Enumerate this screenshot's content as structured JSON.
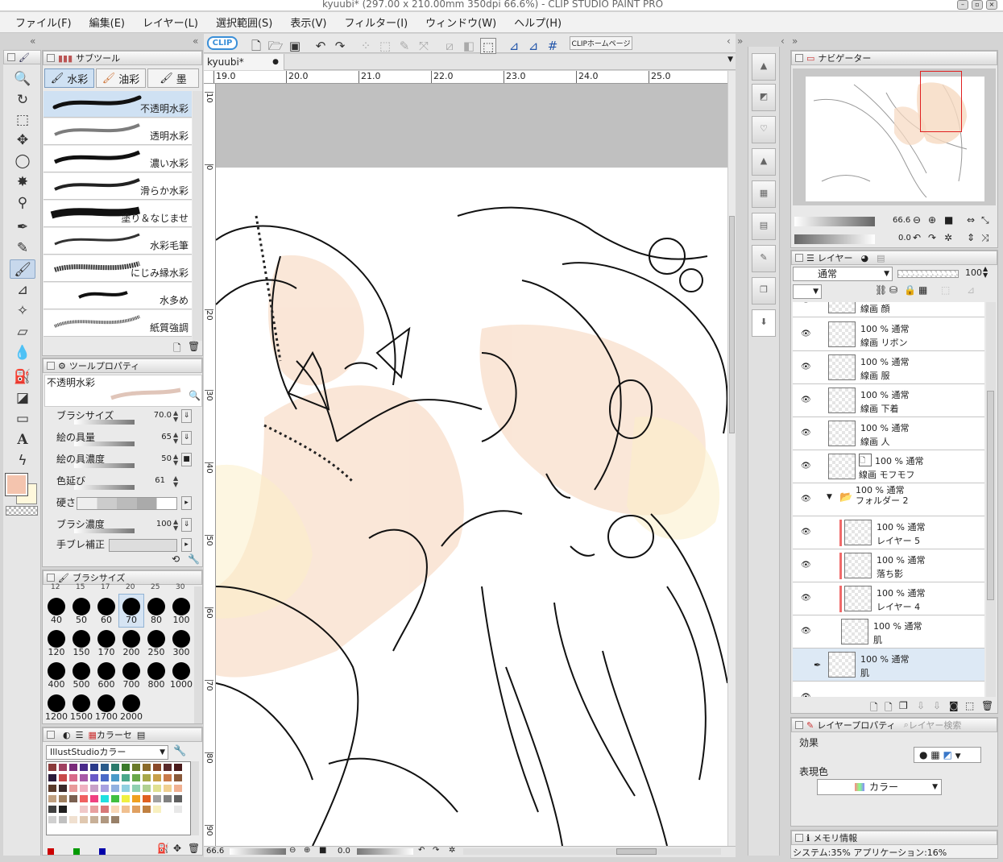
{
  "window": {
    "title": "kyuubi* (297.00 x 210.00mm 350dpi 66.6%)  - CLIP STUDIO PAINT PRO"
  },
  "menu": [
    "ファイル(F)",
    "編集(E)",
    "レイヤー(L)",
    "選択範囲(S)",
    "表示(V)",
    "フィルター(I)",
    "ウィンドウ(W)",
    "ヘルプ(H)"
  ],
  "toolbar": {
    "clip_logo": "CLIP",
    "home_button": "CLIPホームページ"
  },
  "subtool": {
    "panel_title": "サブツール",
    "tabs": [
      "水彩",
      "油彩",
      "墨"
    ],
    "brushes": [
      "不透明水彩",
      "透明水彩",
      "濃い水彩",
      "滑らか水彩",
      "塗り＆なじませ",
      "水彩毛筆",
      "にじみ縁水彩",
      "水多め",
      "紙質強調"
    ]
  },
  "tool_property": {
    "panel_title": "ツールプロパティ",
    "tool_name": "不透明水彩",
    "rows": [
      {
        "label": "ブラシサイズ",
        "value": "70.0"
      },
      {
        "label": "絵の具量",
        "value": "65"
      },
      {
        "label": "絵の具濃度",
        "value": "50"
      },
      {
        "label": "色延び",
        "value": "61"
      },
      {
        "label": "硬さ",
        "value": ""
      },
      {
        "label": "ブラシ濃度",
        "value": "100"
      },
      {
        "label": "手ブレ補正",
        "value": ""
      }
    ]
  },
  "brush_size": {
    "panel_title": "ブラシサイズ",
    "top_partial": [
      "12",
      "15",
      "17",
      "20",
      "25",
      "30"
    ],
    "sizes": [
      "40",
      "50",
      "60",
      "70",
      "80",
      "100",
      "120",
      "150",
      "170",
      "200",
      "250",
      "300",
      "400",
      "500",
      "600",
      "700",
      "800",
      "1000",
      "1200",
      "1500",
      "1700",
      "2000"
    ],
    "selected": "70"
  },
  "color_set": {
    "tab_label": "カラーセ",
    "set_name": "IllustStudioカラー"
  },
  "canvas": {
    "tab": "kyuubi*",
    "ruler_h": [
      "19.0",
      "20.0",
      "21.0",
      "22.0",
      "23.0",
      "24.0",
      "25.0"
    ],
    "ruler_v": [
      "10",
      "0",
      "20",
      "30",
      "40",
      "50",
      "60",
      "70",
      "80",
      "90"
    ],
    "zoom": "66.6",
    "angle": "0.0"
  },
  "navigator": {
    "panel_title": "ナビゲーター",
    "zoom": "66.6",
    "angle": "0.0"
  },
  "layers": {
    "panel_title": "レイヤー",
    "blend_mode": "通常",
    "opacity": "100",
    "rows": [
      {
        "line1": "",
        "line2": "線画 顔"
      },
      {
        "line1": "100 % 通常",
        "line2": "線画 リボン"
      },
      {
        "line1": "100 % 通常",
        "line2": "線画 服"
      },
      {
        "line1": "100 % 通常",
        "line2": "線画 下着"
      },
      {
        "line1": "100 % 通常",
        "line2": "線画 人"
      },
      {
        "line1": "100 % 通常",
        "line2": "線画 モフモフ"
      },
      {
        "line1": "100 % 通常",
        "line2": "フォルダー 2"
      },
      {
        "line1": "100 % 通常",
        "line2": "レイヤー 5"
      },
      {
        "line1": "100 % 通常",
        "line2": "落ち影"
      },
      {
        "line1": "100 % 通常",
        "line2": "レイヤー 4"
      },
      {
        "line1": "100 % 通常",
        "line2": "肌"
      },
      {
        "line1": "100 % 通常",
        "line2": "肌"
      }
    ]
  },
  "layer_property": {
    "panel_title": "レイヤープロパティ",
    "search_tab": "レイヤー検索",
    "effect_label": "効果",
    "expression_label": "表現色",
    "expression_value": "カラー"
  },
  "memory": {
    "panel_title": "メモリ情報",
    "status": "システム:35%  アプリケーション:16%"
  },
  "colors": {
    "main": "#f4c4ae",
    "sub": "#fff8dc",
    "accent_blue": "#3a78c9",
    "nav_frame": "#e02020"
  }
}
